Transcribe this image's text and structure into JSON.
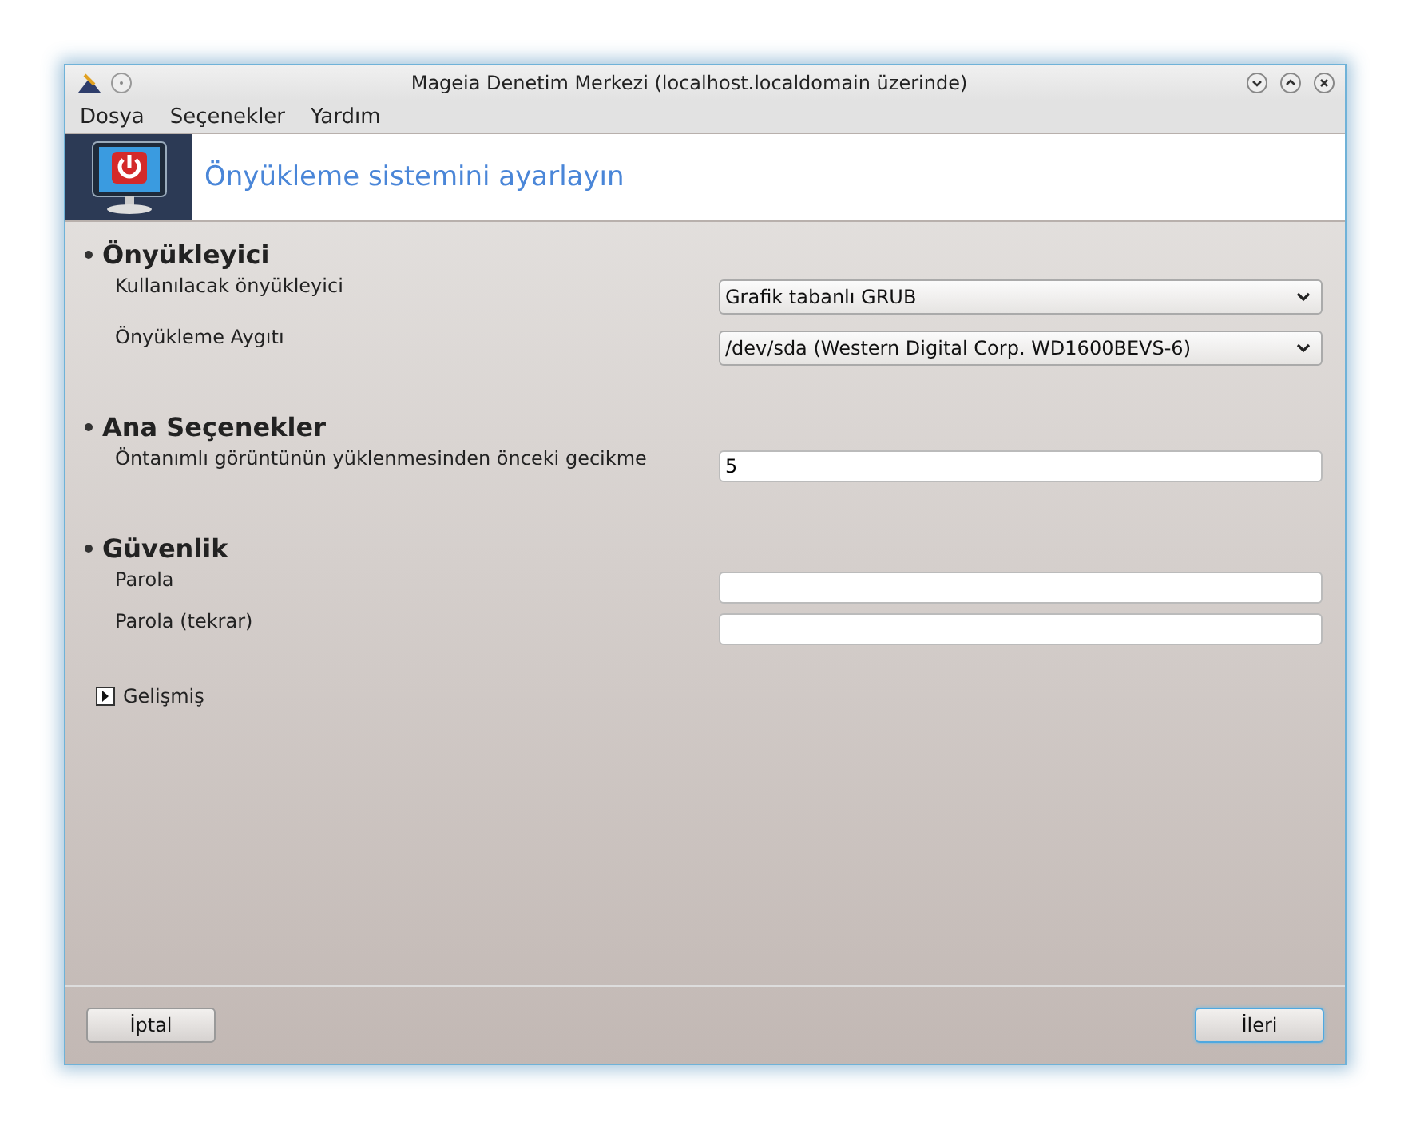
{
  "window": {
    "title": "Mageia Denetim Merkezi  (localhost.localdomain üzerinde)"
  },
  "menu": [
    "Dosya",
    "Seçenekler",
    "Yardım"
  ],
  "header": {
    "title": "Önyükleme sistemini ayarlayın"
  },
  "sections": [
    {
      "title": "Önyükleyici",
      "fields": [
        {
          "kind": "combo",
          "label": "Kullanılacak önyükleyici",
          "value": "Grafik tabanlı GRUB"
        },
        {
          "kind": "combo",
          "label": "Önyükleme Aygıtı",
          "value": "/dev/sda (Western Digital Corp. WD1600BEVS-6)"
        }
      ]
    },
    {
      "title": "Ana Seçenekler",
      "fields": [
        {
          "kind": "text",
          "label": "Öntanımlı görüntünün yüklenmesinden önceki gecikme",
          "value": "5"
        }
      ]
    },
    {
      "title": "Güvenlik",
      "fields": [
        {
          "kind": "text",
          "label": "Parola"
        },
        {
          "kind": "text",
          "label": "Parola (tekrar)"
        }
      ]
    }
  ],
  "expander": {
    "label": "Gelişmiş",
    "expanded": false
  },
  "buttons": [
    {
      "label": "İptal",
      "focused": false
    },
    {
      "label": "İleri",
      "focused": true
    }
  ]
}
